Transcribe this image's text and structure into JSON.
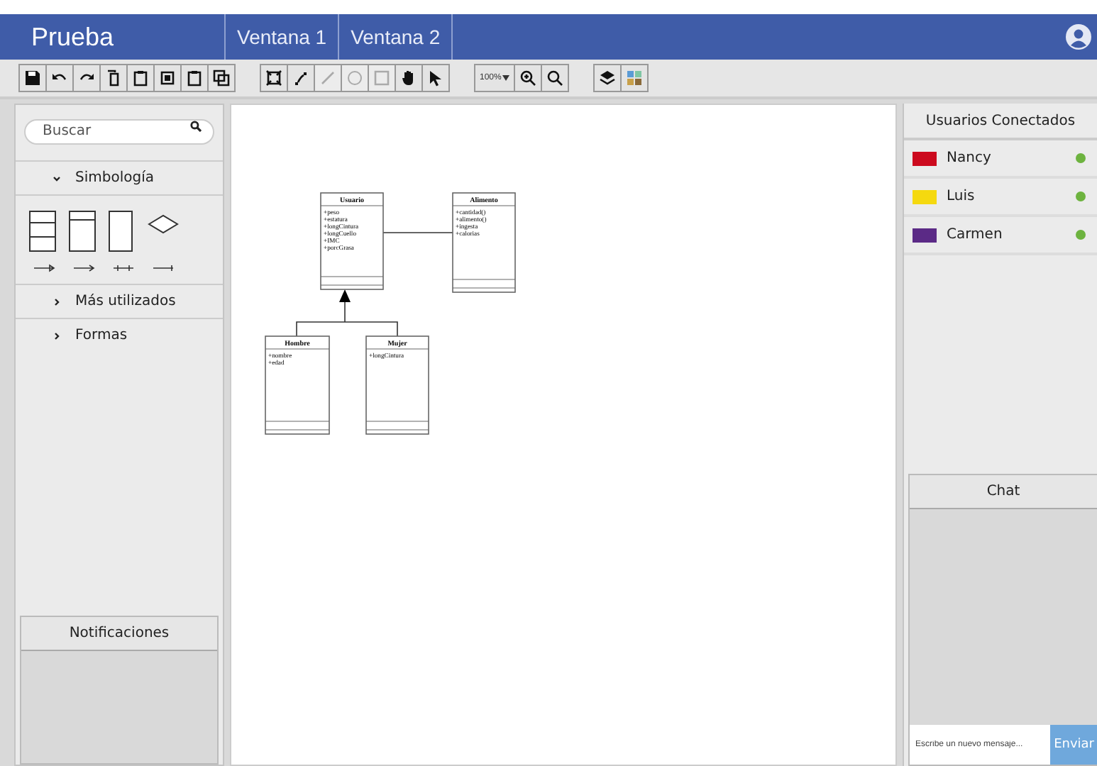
{
  "app": {
    "title": "Prueba"
  },
  "tabs": [
    {
      "label": "Ventana 1"
    },
    {
      "label": "Ventana 2"
    }
  ],
  "toolbar": {
    "groups": [
      [
        {
          "kind": "save"
        },
        {
          "kind": "undo"
        },
        {
          "kind": "redo"
        },
        {
          "kind": "copy"
        },
        {
          "kind": "paste"
        },
        {
          "kind": "select"
        },
        {
          "kind": "clipboard"
        },
        {
          "kind": "duplicate"
        }
      ],
      [
        {
          "kind": "fit",
          "disabled": false
        },
        {
          "kind": "connect",
          "disabled": false
        },
        {
          "kind": "line",
          "disabled": true
        },
        {
          "kind": "circle",
          "disabled": true
        },
        {
          "kind": "rect",
          "disabled": true
        },
        {
          "kind": "hand",
          "disabled": false
        },
        {
          "kind": "pointer",
          "disabled": false
        }
      ],
      [
        {
          "kind": "zoom",
          "label": "100%"
        },
        {
          "kind": "zoomin"
        },
        {
          "kind": "zoomout"
        }
      ],
      [
        {
          "kind": "layers"
        },
        {
          "kind": "palette"
        }
      ]
    ]
  },
  "sidebar": {
    "search": {
      "placeholder": "Buscar"
    },
    "sections": [
      {
        "label": "Simbología",
        "expanded": true
      },
      {
        "label": "Más utilizados",
        "expanded": false
      },
      {
        "label": "Formas",
        "expanded": false
      }
    ]
  },
  "notifications": {
    "title": "Notificaciones"
  },
  "diagram": {
    "classes": [
      {
        "name": "Usuario",
        "attributes": [
          "+peso",
          "+estatura",
          "+longCintura",
          "+longCuello",
          "+IMC",
          "+porcGrasa"
        ]
      },
      {
        "name": "Alimento",
        "attributes": [
          "+cantidad()",
          "+alimento()",
          "+ingesta",
          "+calorias"
        ]
      },
      {
        "name": "Hombre",
        "attributes": [
          "+nombre",
          "+edad"
        ]
      },
      {
        "name": "Mujer",
        "attributes": [
          "+longCintura"
        ]
      }
    ]
  },
  "users": {
    "title": "Usuarios Conectados",
    "items": [
      {
        "name": "Nancy",
        "color": "#cc0a1e",
        "online": true
      },
      {
        "name": "Luis",
        "color": "#f5d90f",
        "online": true
      },
      {
        "name": "Carmen",
        "color": "#5b2a86",
        "online": true
      }
    ]
  },
  "chat": {
    "title": "Chat",
    "placeholder": "Escribe un nuevo mensaje...",
    "send": "Enviar"
  }
}
